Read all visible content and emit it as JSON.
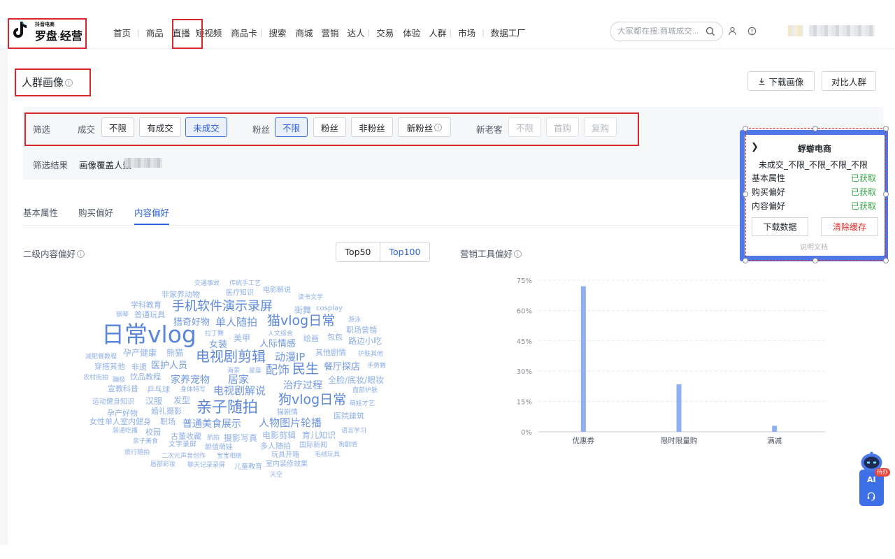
{
  "app": {
    "logo_small": "抖音电商",
    "logo_main_1": "罗盘",
    "logo_dot": "·",
    "logo_main_2": "经营"
  },
  "nav": {
    "items": [
      "首页",
      "商品",
      "直播",
      "短视频",
      "商品卡",
      "搜索",
      "商城",
      "营销",
      "达人",
      "交易",
      "体验",
      "人群",
      "市场",
      "数据工厂"
    ],
    "active": "直播"
  },
  "search": {
    "placeholder": "大家都在搜:商城成交..."
  },
  "page": {
    "title": "人群画像",
    "download_label": "下载画像",
    "compare_label": "对比人群"
  },
  "filters": {
    "label": "筛选",
    "deal": {
      "label": "成交",
      "options": [
        "不限",
        "有成交",
        "未成交"
      ],
      "selected": "未成交"
    },
    "fans": {
      "label": "粉丝",
      "options": [
        "不限",
        "粉丝",
        "非粉丝",
        "新粉丝"
      ],
      "selected": "不限"
    },
    "customer": {
      "label": "新老客",
      "options": [
        "不限",
        "首购",
        "复购"
      ]
    },
    "result_label": "筛选结果",
    "result_text": "画像覆盖人数"
  },
  "tabs": {
    "items": [
      "基本属性",
      "购买偏好",
      "内容偏好"
    ],
    "active": "内容偏好"
  },
  "content_pref": {
    "title": "二级内容偏好",
    "top50": "Top50",
    "top100": "Top100",
    "active": "Top100",
    "words": [
      {
        "t": "交通事故",
        "s": 0
      },
      {
        "t": "传统手工艺",
        "s": 0
      },
      {
        "t": "非家养动物",
        "s": 0
      },
      {
        "t": "医疗知识",
        "s": 0
      },
      {
        "t": "电影解说",
        "s": 0
      },
      {
        "t": "读书文学",
        "s": 0
      },
      {
        "t": "学科教育",
        "s": 0
      },
      {
        "t": "手机软件演示录屏",
        "s": 2
      },
      {
        "t": "街舞",
        "s": 0
      },
      {
        "t": "cosplay",
        "s": 0
      },
      {
        "t": "钢琴",
        "s": 0
      },
      {
        "t": "普通玩具",
        "s": 0
      },
      {
        "t": "游泳",
        "s": 0
      },
      {
        "t": "猎奇好物",
        "s": 1
      },
      {
        "t": "单人随拍",
        "s": 1
      },
      {
        "t": "猫vlog日常",
        "s": 2
      },
      {
        "t": "职场营销",
        "s": 0
      },
      {
        "t": "日常vlog",
        "s": 3
      },
      {
        "t": "拉丁舞",
        "s": 0
      },
      {
        "t": "美甲",
        "s": 0
      },
      {
        "t": "人文综合",
        "s": 0
      },
      {
        "t": "绘画",
        "s": 0
      },
      {
        "t": "包包",
        "s": 0
      },
      {
        "t": "路边小吃",
        "s": 0
      },
      {
        "t": "女装",
        "s": 1
      },
      {
        "t": "人际情感",
        "s": 1
      },
      {
        "t": "孕产健康",
        "s": 0
      },
      {
        "t": "熊猫",
        "s": 0
      },
      {
        "t": "其他剧情",
        "s": 0
      },
      {
        "t": "减肥餐教程",
        "s": 0
      },
      {
        "t": "电视剧剪辑",
        "s": 2
      },
      {
        "t": "动漫IP",
        "s": 1
      },
      {
        "t": "护肤其他",
        "s": 0
      },
      {
        "t": "穿搭其他",
        "s": 0
      },
      {
        "t": "非遗",
        "s": 0
      },
      {
        "t": "医护人员",
        "s": 1
      },
      {
        "t": "海景",
        "s": 0
      },
      {
        "t": "星座",
        "s": 0
      },
      {
        "t": "配饰",
        "s": 1
      },
      {
        "t": "民生",
        "s": 2
      },
      {
        "t": "餐厅探店",
        "s": 1
      },
      {
        "t": "手势舞",
        "s": 0
      },
      {
        "t": "农村街拍",
        "s": 0
      },
      {
        "t": "蹦极",
        "s": 0
      },
      {
        "t": "饮品教程",
        "s": 0
      },
      {
        "t": "家养宠物",
        "s": 1
      },
      {
        "t": "居家",
        "s": 1
      },
      {
        "t": "全脸/底妆/眼妆",
        "s": 0
      },
      {
        "t": "宣教科普",
        "s": 0
      },
      {
        "t": "乒乓球",
        "s": 0
      },
      {
        "t": "身体特写",
        "s": 0
      },
      {
        "t": "电视剧解说",
        "s": 1
      },
      {
        "t": "治疗过程",
        "s": 1
      },
      {
        "t": "面部护肤",
        "s": 0
      },
      {
        "t": "运动健身知识",
        "s": 0
      },
      {
        "t": "汉服",
        "s": 0
      },
      {
        "t": "发型",
        "s": 0
      },
      {
        "t": "狗vlog日常",
        "s": 2
      },
      {
        "t": "萌娃才艺",
        "s": 0
      },
      {
        "t": "亲子随拍",
        "s": 2
      },
      {
        "t": "孕产好物",
        "s": 0
      },
      {
        "t": "婚礼摄影",
        "s": 0
      },
      {
        "t": "猫剧情",
        "s": 0
      },
      {
        "t": "医院建筑",
        "s": 0
      },
      {
        "t": "女性单人室内健身",
        "s": 0
      },
      {
        "t": "职场",
        "s": 0
      },
      {
        "t": "普通美食展示",
        "s": 1
      },
      {
        "t": "人物图片轮播",
        "s": 1
      },
      {
        "t": "普通吃播",
        "s": 0
      },
      {
        "t": "校园",
        "s": 0
      },
      {
        "t": "语言学习",
        "s": 0
      },
      {
        "t": "古董收藏",
        "s": 0
      },
      {
        "t": "航拍",
        "s": 0
      },
      {
        "t": "摄影写真",
        "s": 0
      },
      {
        "t": "电影剪辑",
        "s": 0
      },
      {
        "t": "育儿知识",
        "s": 0
      },
      {
        "t": "亲子美食",
        "s": 0
      },
      {
        "t": "文字录屏",
        "s": 0
      },
      {
        "t": "颜值萌娃",
        "s": 0
      },
      {
        "t": "多人随拍",
        "s": 0
      },
      {
        "t": "国际新闻",
        "s": 0
      },
      {
        "t": "狗剧情",
        "s": 0
      },
      {
        "t": "旅行随拍",
        "s": 0
      },
      {
        "t": "二次元声音创作",
        "s": 0
      },
      {
        "t": "宝宝相册",
        "s": 0
      },
      {
        "t": "玩具开箱",
        "s": 0
      },
      {
        "t": "毛绒玩具",
        "s": 0
      },
      {
        "t": "唇部彩妆",
        "s": 0
      },
      {
        "t": "聊天记录录屏",
        "s": 0
      },
      {
        "t": "儿童教育",
        "s": 0
      },
      {
        "t": "室内装修效果",
        "s": 0
      },
      {
        "t": "天空",
        "s": 0
      }
    ]
  },
  "marketing": {
    "title": "营销工具偏好",
    "chart_data": {
      "type": "bar",
      "categories": [
        "优惠券",
        "限时限量购",
        "满减"
      ],
      "values": [
        72,
        23.5,
        3
      ],
      "yticks": [
        "0%",
        "15%",
        "30%",
        "45%",
        "60%",
        "75%"
      ],
      "ylim": [
        0,
        75
      ],
      "grid": true,
      "color": "#8eb0f2"
    }
  },
  "extension": {
    "title": "蜉蝣电商",
    "subtitle": "未成交_不限_不限_不限_不限",
    "rows": [
      {
        "label": "基本属性",
        "status": "已获取"
      },
      {
        "label": "购买偏好",
        "status": "已获取"
      },
      {
        "label": "内容偏好",
        "status": "已获取"
      }
    ],
    "download_label": "下载数据",
    "clear_label": "清除缓存",
    "doc_label": "说明文档"
  },
  "ai": {
    "label": "AI",
    "badge": "待办"
  },
  "colors": {
    "accent": "#2e62d9",
    "highlight": "#d9262c",
    "success": "#3aa54a",
    "danger": "#e02b2b"
  }
}
